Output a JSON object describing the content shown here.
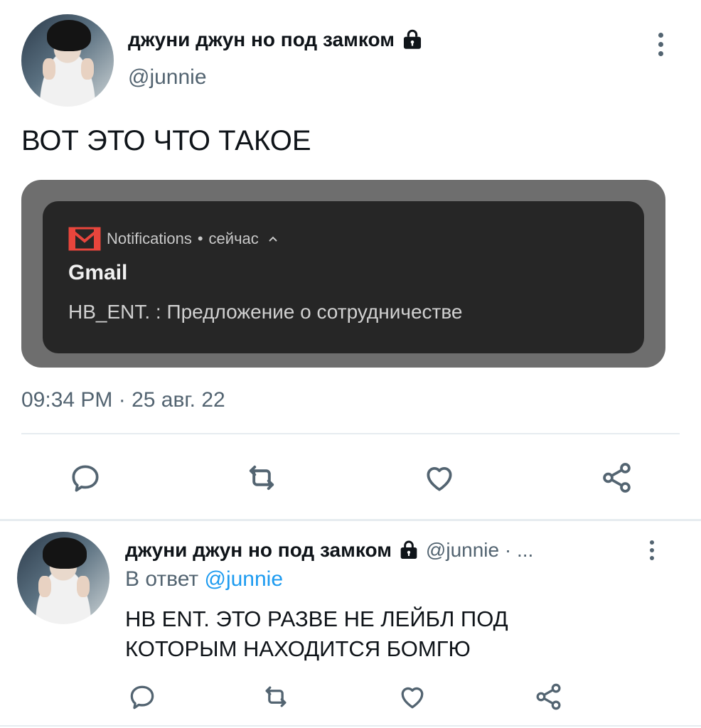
{
  "tweet": {
    "display_name": "джуни джун но под замком",
    "handle": "@junnie",
    "text": "ВОТ ЭТО ЧТО ТАКОЕ",
    "timestamp": "09:34 PM · 25 авг. 22",
    "notification": {
      "source": "Notifications",
      "time": "сейчас",
      "app": "Gmail",
      "message": "HB_ENT. : Предложение о сотрудничестве"
    }
  },
  "reply": {
    "display_name": "джуни джун но под замком",
    "handle_meta": "@junnie · ...",
    "reply_prefix": "В ответ",
    "reply_to": "@junnie",
    "text_line1": "HB ENT. ЭТО РАЗВЕ НЕ ЛЕЙБЛ ПОД",
    "text_line2": "КОТОРЫМ НАХОДИТСЯ БОМГЮ"
  },
  "icons": [
    "lock-icon",
    "more-options-icon",
    "gmail-icon",
    "chevron-up-icon",
    "reply-icon",
    "retweet-icon",
    "like-icon",
    "share-icon"
  ],
  "colors": {
    "text": "#0f1419",
    "muted": "#536471",
    "link": "#1d9bf0",
    "gmail_red": "#e8453c"
  }
}
